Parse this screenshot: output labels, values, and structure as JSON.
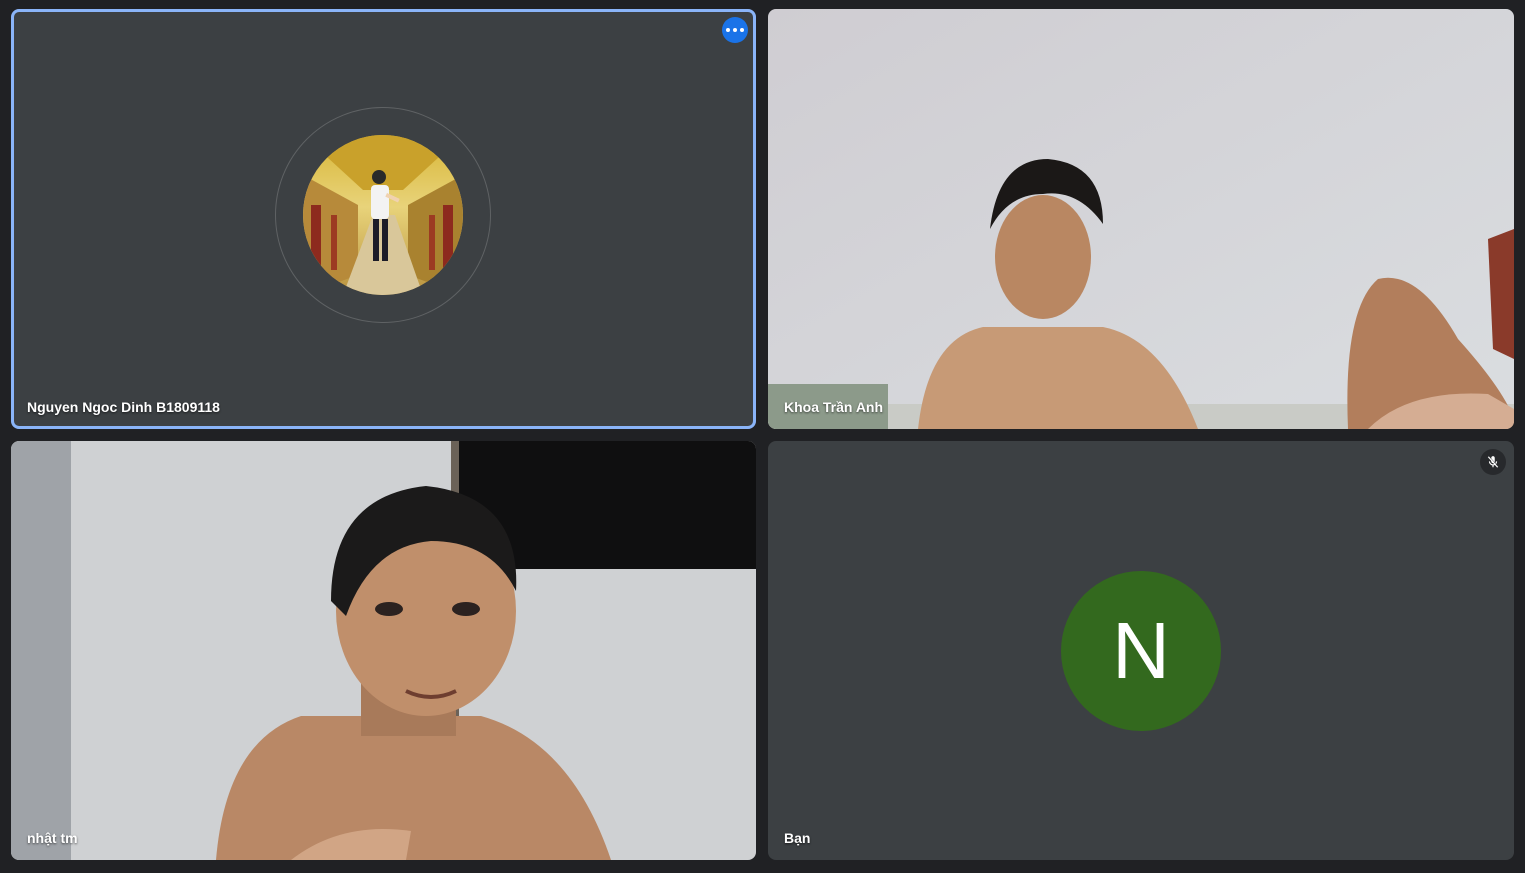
{
  "participants": [
    {
      "name": "Nguyen Ngoc Dinh B1809118",
      "state": "avatar-photo",
      "active_speaker": true,
      "more_options_icon": "more-horizontal-icon"
    },
    {
      "name": "Khoa Trần Anh",
      "state": "video"
    },
    {
      "name": "nhật tm",
      "state": "video"
    },
    {
      "name": "Bạn",
      "state": "avatar-letter",
      "initial": "N",
      "avatar_color": "#33691e",
      "muted": true,
      "mute_icon": "mic-off-icon"
    }
  ],
  "colors": {
    "background": "#202124",
    "tile": "#3c4043",
    "active_border": "#8ab4f8",
    "more_button": "#1a73e8"
  }
}
